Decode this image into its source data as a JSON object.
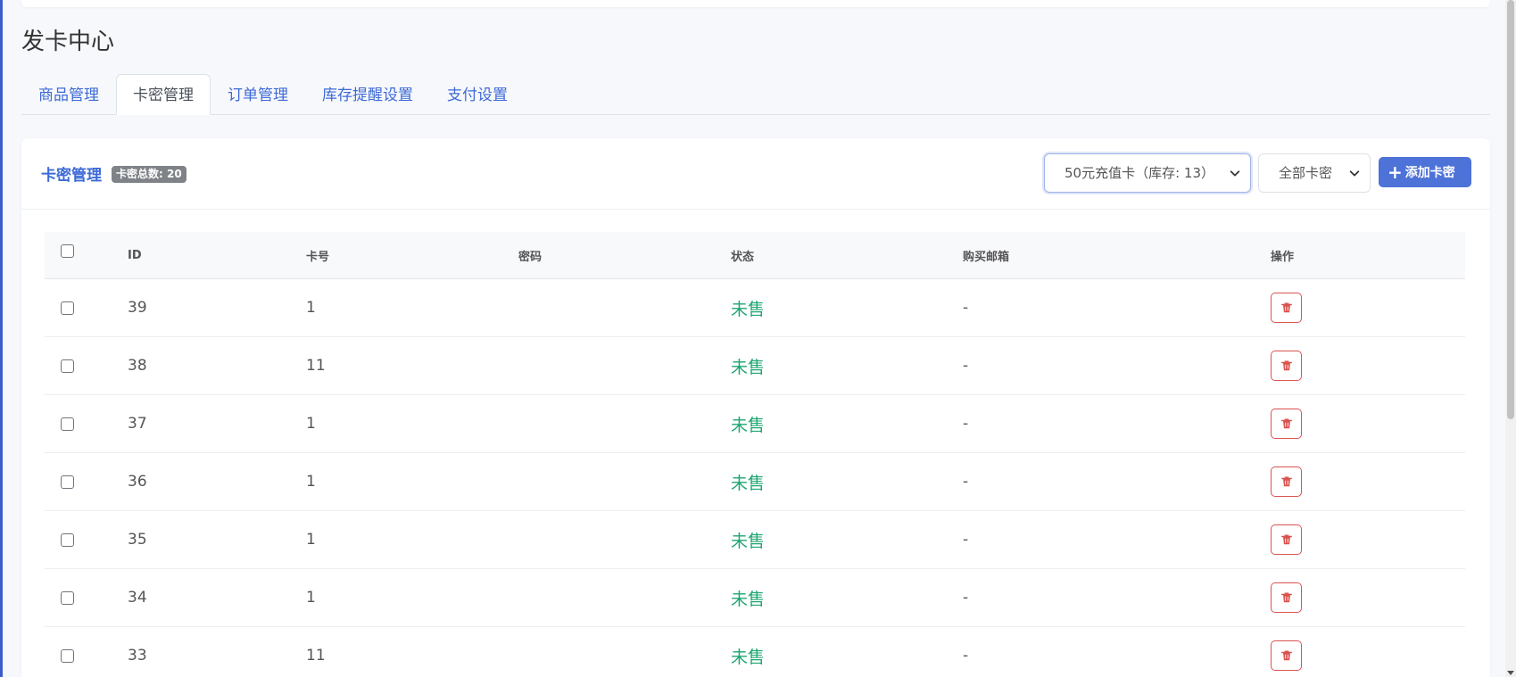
{
  "page": {
    "title": "发卡中心"
  },
  "tabs": [
    {
      "label": "商品管理",
      "active": false
    },
    {
      "label": "卡密管理",
      "active": true
    },
    {
      "label": "订单管理",
      "active": false
    },
    {
      "label": "库存提醒设置",
      "active": false
    },
    {
      "label": "支付设置",
      "active": false
    }
  ],
  "card": {
    "title": "卡密管理",
    "badge": "卡密总数: 20",
    "product_select": "50元充值卡（库存: 13）",
    "status_select": "全部卡密",
    "add_button": "添加卡密"
  },
  "table": {
    "headers": {
      "id": "ID",
      "card_no": "卡号",
      "password": "密码",
      "status": "状态",
      "email": "购买邮箱",
      "actions": "操作"
    },
    "rows": [
      {
        "id": "39",
        "card_no": "1",
        "password": "",
        "status": "未售",
        "email": "-"
      },
      {
        "id": "38",
        "card_no": "11",
        "password": "",
        "status": "未售",
        "email": "-"
      },
      {
        "id": "37",
        "card_no": "1",
        "password": "",
        "status": "未售",
        "email": "-"
      },
      {
        "id": "36",
        "card_no": "1",
        "password": "",
        "status": "未售",
        "email": "-"
      },
      {
        "id": "35",
        "card_no": "1",
        "password": "",
        "status": "未售",
        "email": "-"
      },
      {
        "id": "34",
        "card_no": "1",
        "password": "",
        "status": "未售",
        "email": "-"
      },
      {
        "id": "33",
        "card_no": "11",
        "password": "",
        "status": "未售",
        "email": "-"
      }
    ]
  },
  "colors": {
    "accent": "#3d6ad6",
    "button": "#4d72d8",
    "unsold": "#1ea672",
    "danger": "#d9534f",
    "badge": "#7f8388"
  },
  "icons": {
    "trash": "trash-icon",
    "plus": "plus-icon",
    "chevron": "chevron-down-icon"
  }
}
